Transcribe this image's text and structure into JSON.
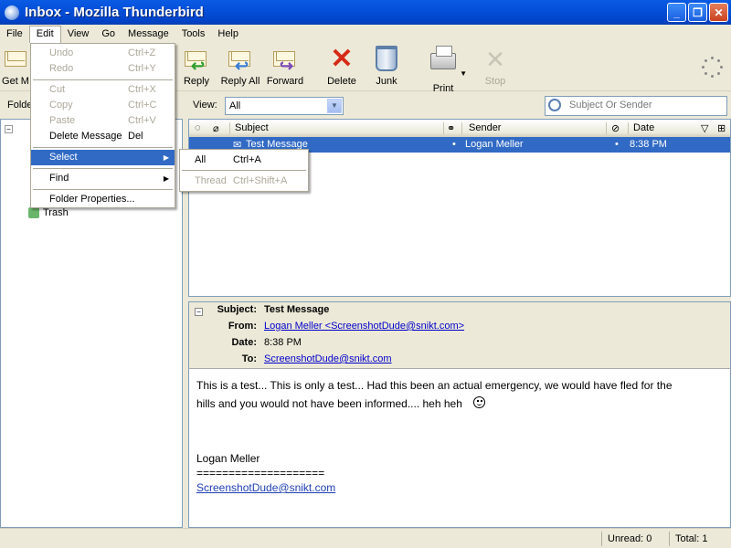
{
  "window": {
    "title": "Inbox - Mozilla Thunderbird"
  },
  "menubar": [
    "File",
    "Edit",
    "View",
    "Go",
    "Message",
    "Tools",
    "Help"
  ],
  "toolbar": {
    "get_mail": "Get M",
    "reply": "Reply",
    "reply_all": "Reply All",
    "forward": "Forward",
    "delete": "Delete",
    "junk": "Junk",
    "print": "Print",
    "stop": "Stop"
  },
  "folder_pane": {
    "header": "Folde",
    "trash": "Trash"
  },
  "view": {
    "label": "View:",
    "selected": "All"
  },
  "search": {
    "placeholder": "Subject Or Sender"
  },
  "columns": {
    "subject": "Subject",
    "sender": "Sender",
    "date": "Date"
  },
  "messages": [
    {
      "subject": "Test Message",
      "sender": "Logan Meller",
      "date": "8:38 PM",
      "selected": true
    }
  ],
  "message_header": {
    "subject_label": "Subject:",
    "subject": "Test Message",
    "from_label": "From:",
    "from": "Logan Meller <ScreenshotDude@snikt.com>",
    "date_label": "Date:",
    "date": "8:38 PM",
    "to_label": "To:",
    "to": "ScreenshotDude@snikt.com"
  },
  "message_body": {
    "line1": "This is a test... This is only a test... Had this been an actual emergency, we would have fled for the",
    "line2": "hills and you would not have been informed.... heh heh",
    "sig_name": "Logan Meller",
    "sig_rule": "====================",
    "sig_email": "ScreenshotDude@snikt.com"
  },
  "status": {
    "unread": "Unread: 0",
    "total": "Total: 1"
  },
  "edit_menu": {
    "undo": {
      "label": "Undo",
      "shortcut": "Ctrl+Z"
    },
    "redo": {
      "label": "Redo",
      "shortcut": "Ctrl+Y"
    },
    "cut": {
      "label": "Cut",
      "shortcut": "Ctrl+X"
    },
    "copy": {
      "label": "Copy",
      "shortcut": "Ctrl+C"
    },
    "paste": {
      "label": "Paste",
      "shortcut": "Ctrl+V"
    },
    "delete_message": {
      "label": "Delete Message",
      "shortcut": "Del"
    },
    "select": {
      "label": "Select"
    },
    "find": {
      "label": "Find"
    },
    "folder_properties": {
      "label": "Folder Properties..."
    }
  },
  "select_submenu": {
    "all": {
      "label": "All",
      "shortcut": "Ctrl+A"
    },
    "thread": {
      "label": "Thread",
      "shortcut": "Ctrl+Shift+A"
    }
  },
  "colors": {
    "selection": "#316AC5",
    "titlebar": "#0450DA",
    "delete_red": "#D62A18"
  }
}
